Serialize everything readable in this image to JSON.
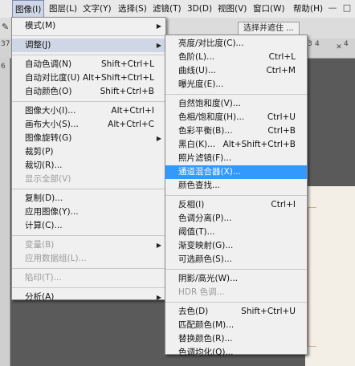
{
  "menubar": {
    "items": [
      {
        "label": "图像(I)",
        "active": true
      },
      {
        "label": "图层(L)"
      },
      {
        "label": "文字(Y)"
      },
      {
        "label": "选择(S)"
      },
      {
        "label": "滤镜(T)"
      },
      {
        "label": "3D(D)"
      },
      {
        "label": "视图(V)"
      },
      {
        "label": "窗口(W)"
      },
      {
        "label": "帮助(H)"
      }
    ],
    "window_buttons": {
      "minimize": "—",
      "restore": "□"
    }
  },
  "options_bar": {
    "select_mask_button": "选择并遮住 ...",
    "ruler_numbers": [
      "37",
      "3",
      "4",
      "4",
      "6"
    ]
  },
  "image_menu": {
    "items": [
      {
        "label": "模式(M)",
        "submenu": true
      },
      {
        "separator": true
      },
      {
        "label": "调整(J)",
        "submenu": true,
        "open": true
      },
      {
        "separator": true
      },
      {
        "label": "自动色调(N)",
        "shortcut": "Shift+Ctrl+L"
      },
      {
        "label": "自动对比度(U)",
        "shortcut": "Alt+Shift+Ctrl+L"
      },
      {
        "label": "自动颜色(O)",
        "shortcut": "Shift+Ctrl+B"
      },
      {
        "separator": true
      },
      {
        "label": "图像大小(I)...",
        "shortcut": "Alt+Ctrl+I"
      },
      {
        "label": "画布大小(S)...",
        "shortcut": "Alt+Ctrl+C"
      },
      {
        "label": "图像旋转(G)",
        "submenu": true
      },
      {
        "label": "裁剪(P)"
      },
      {
        "label": "裁切(R)..."
      },
      {
        "label": "显示全部(V)",
        "disabled": true
      },
      {
        "separator": true
      },
      {
        "label": "复制(D)..."
      },
      {
        "label": "应用图像(Y)..."
      },
      {
        "label": "计算(C)..."
      },
      {
        "separator": true
      },
      {
        "label": "变量(B)",
        "submenu": true,
        "disabled": true
      },
      {
        "label": "应用数据组(L)...",
        "disabled": true
      },
      {
        "separator": true
      },
      {
        "label": "陷印(T)...",
        "disabled": true
      },
      {
        "separator": true
      },
      {
        "label": "分析(A)",
        "submenu": true
      }
    ]
  },
  "adjust_menu": {
    "items": [
      {
        "label": "亮度/对比度(C)..."
      },
      {
        "label": "色阶(L)...",
        "shortcut": "Ctrl+L"
      },
      {
        "label": "曲线(U)...",
        "shortcut": "Ctrl+M"
      },
      {
        "label": "曝光度(E)..."
      },
      {
        "separator": true
      },
      {
        "label": "自然饱和度(V)..."
      },
      {
        "label": "色相/饱和度(H)...",
        "shortcut": "Ctrl+U"
      },
      {
        "label": "色彩平衡(B)...",
        "shortcut": "Ctrl+B"
      },
      {
        "label": "黑白(K)...",
        "shortcut": "Alt+Shift+Ctrl+B"
      },
      {
        "label": "照片滤镜(F)..."
      },
      {
        "label": "通道混合器(X)...",
        "highlighted": true
      },
      {
        "label": "颜色查找..."
      },
      {
        "separator": true
      },
      {
        "label": "反相(I)",
        "shortcut": "Ctrl+I"
      },
      {
        "label": "色调分离(P)..."
      },
      {
        "label": "阈值(T)..."
      },
      {
        "label": "渐变映射(G)..."
      },
      {
        "label": "可选颜色(S)..."
      },
      {
        "separator": true
      },
      {
        "label": "阴影/高光(W)..."
      },
      {
        "label": "HDR 色调...",
        "disabled": true
      },
      {
        "separator": true
      },
      {
        "label": "去色(D)",
        "shortcut": "Shift+Ctrl+U"
      },
      {
        "label": "匹配颜色(M)..."
      },
      {
        "label": "替换颜色(R)..."
      },
      {
        "label": "色调均化(Q)..."
      }
    ]
  }
}
